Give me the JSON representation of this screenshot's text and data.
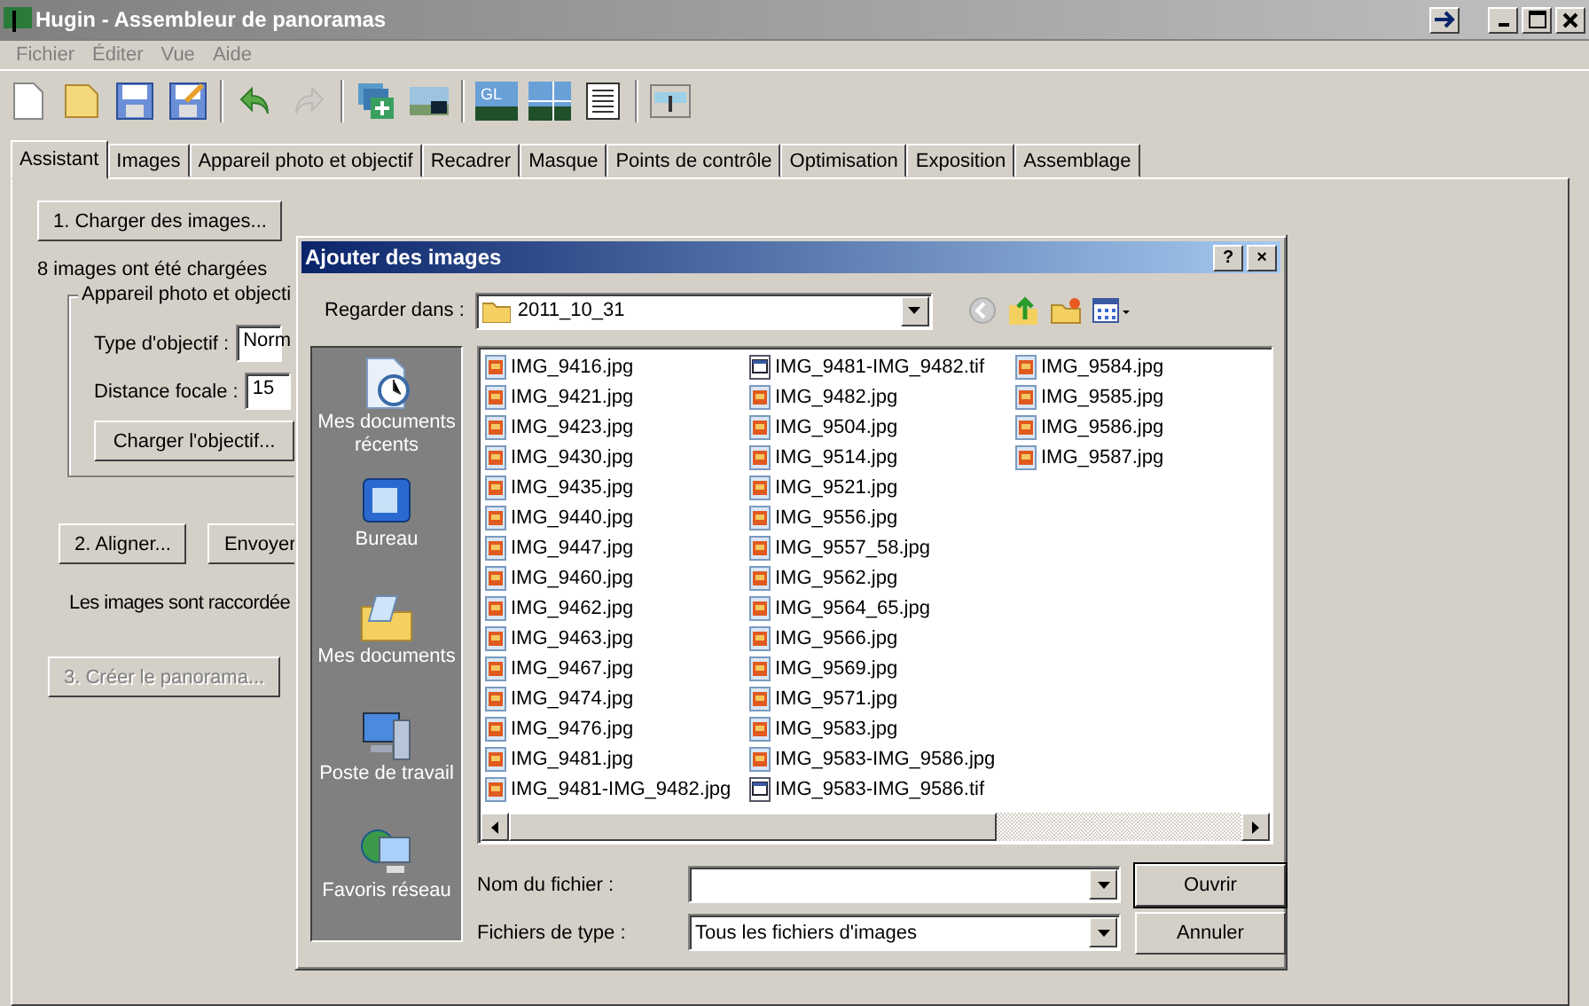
{
  "window": {
    "title": "Hugin - Assembleur de panoramas"
  },
  "menu": [
    "Fichier",
    "Éditer",
    "Vue",
    "Aide"
  ],
  "toolbar": [
    {
      "kind": "new",
      "disabled": false
    },
    {
      "kind": "open",
      "disabled": false
    },
    {
      "kind": "save",
      "disabled": false
    },
    {
      "kind": "saveas",
      "disabled": false
    },
    {
      "kind": "sep"
    },
    {
      "kind": "undo",
      "disabled": false
    },
    {
      "kind": "redo",
      "disabled": true
    },
    {
      "kind": "sep"
    },
    {
      "kind": "addimages",
      "disabled": false
    },
    {
      "kind": "align",
      "disabled": false
    },
    {
      "kind": "sep"
    },
    {
      "kind": "gl",
      "label": "GL",
      "disabled": false
    },
    {
      "kind": "preview",
      "disabled": false
    },
    {
      "kind": "list",
      "disabled": false
    },
    {
      "kind": "sep"
    },
    {
      "kind": "stitch",
      "disabled": false
    }
  ],
  "tabs": [
    {
      "label": "Assistant",
      "selected": true
    },
    {
      "label": "Images",
      "selected": false
    },
    {
      "label": "Appareil photo et objectif",
      "selected": false
    },
    {
      "label": "Recadrer",
      "selected": false
    },
    {
      "label": "Masque",
      "selected": false
    },
    {
      "label": "Points de contrôle",
      "selected": false
    },
    {
      "label": "Optimisation",
      "selected": false
    },
    {
      "label": "Exposition",
      "selected": false
    },
    {
      "label": "Assemblage",
      "selected": false
    }
  ],
  "assistant": {
    "load_button": {
      "label": "1. Charger des images...",
      "disabled": false
    },
    "status": "8 images ont été chargées",
    "lens_group": {
      "title": "Appareil photo et objecti",
      "lens_type_label": "Type d'objectif :",
      "lens_type_value": "Norm",
      "focal_label": "Distance focale :",
      "focal_value": "15",
      "load_lens_button": "Charger l'objectif..."
    },
    "align_button": {
      "label": "2. Aligner...",
      "disabled": false
    },
    "send_button": {
      "label": "Envoyer",
      "disabled": false
    },
    "align_status": "Les images sont raccordée",
    "create_button": {
      "label": "3. Créer le panorama...",
      "disabled": true
    }
  },
  "dialog": {
    "title": "Ajouter des images",
    "look_in_label": "Regarder dans :",
    "look_in_value": "2011_10_31",
    "places": [
      {
        "kind": "recent",
        "label": "Mes documents récents"
      },
      {
        "kind": "desktop",
        "label": "Bureau"
      },
      {
        "kind": "documents",
        "label": "Mes documents"
      },
      {
        "kind": "computer",
        "label": "Poste de travail"
      },
      {
        "kind": "network",
        "label": "Favoris réseau"
      }
    ],
    "files": [
      {
        "name": "IMG_9416.jpg",
        "kind": "jpg"
      },
      {
        "name": "IMG_9421.jpg",
        "kind": "jpg"
      },
      {
        "name": "IMG_9423.jpg",
        "kind": "jpg"
      },
      {
        "name": "IMG_9430.jpg",
        "kind": "jpg"
      },
      {
        "name": "IMG_9435.jpg",
        "kind": "jpg"
      },
      {
        "name": "IMG_9440.jpg",
        "kind": "jpg"
      },
      {
        "name": "IMG_9447.jpg",
        "kind": "jpg"
      },
      {
        "name": "IMG_9460.jpg",
        "kind": "jpg"
      },
      {
        "name": "IMG_9462.jpg",
        "kind": "jpg"
      },
      {
        "name": "IMG_9463.jpg",
        "kind": "jpg"
      },
      {
        "name": "IMG_9467.jpg",
        "kind": "jpg"
      },
      {
        "name": "IMG_9474.jpg",
        "kind": "jpg"
      },
      {
        "name": "IMG_9476.jpg",
        "kind": "jpg"
      },
      {
        "name": "IMG_9481.jpg",
        "kind": "jpg"
      },
      {
        "name": "IMG_9481-IMG_9482.jpg",
        "kind": "jpg"
      },
      {
        "name": "IMG_9481-IMG_9482.tif",
        "kind": "tif"
      },
      {
        "name": "IMG_9482.jpg",
        "kind": "jpg"
      },
      {
        "name": "IMG_9504.jpg",
        "kind": "jpg"
      },
      {
        "name": "IMG_9514.jpg",
        "kind": "jpg"
      },
      {
        "name": "IMG_9521.jpg",
        "kind": "jpg"
      },
      {
        "name": "IMG_9556.jpg",
        "kind": "jpg"
      },
      {
        "name": "IMG_9557_58.jpg",
        "kind": "jpg"
      },
      {
        "name": "IMG_9562.jpg",
        "kind": "jpg"
      },
      {
        "name": "IMG_9564_65.jpg",
        "kind": "jpg"
      },
      {
        "name": "IMG_9566.jpg",
        "kind": "jpg"
      },
      {
        "name": "IMG_9569.jpg",
        "kind": "jpg"
      },
      {
        "name": "IMG_9571.jpg",
        "kind": "jpg"
      },
      {
        "name": "IMG_9583.jpg",
        "kind": "jpg"
      },
      {
        "name": "IMG_9583-IMG_9586.jpg",
        "kind": "jpg"
      },
      {
        "name": "IMG_9583-IMG_9586.tif",
        "kind": "tif"
      },
      {
        "name": "IMG_9584.jpg",
        "kind": "jpg"
      },
      {
        "name": "IMG_9585.jpg",
        "kind": "jpg"
      },
      {
        "name": "IMG_9586.jpg",
        "kind": "jpg"
      },
      {
        "name": "IMG_9587.jpg",
        "kind": "jpg"
      }
    ],
    "filename_label": "Nom du fichier :",
    "filetype_label": "Fichiers de type :",
    "filetype_value": "Tous les fichiers d'images",
    "open_button": "Ouvrir",
    "cancel_button": "Annuler",
    "help_button": "?",
    "close_button": "×"
  }
}
